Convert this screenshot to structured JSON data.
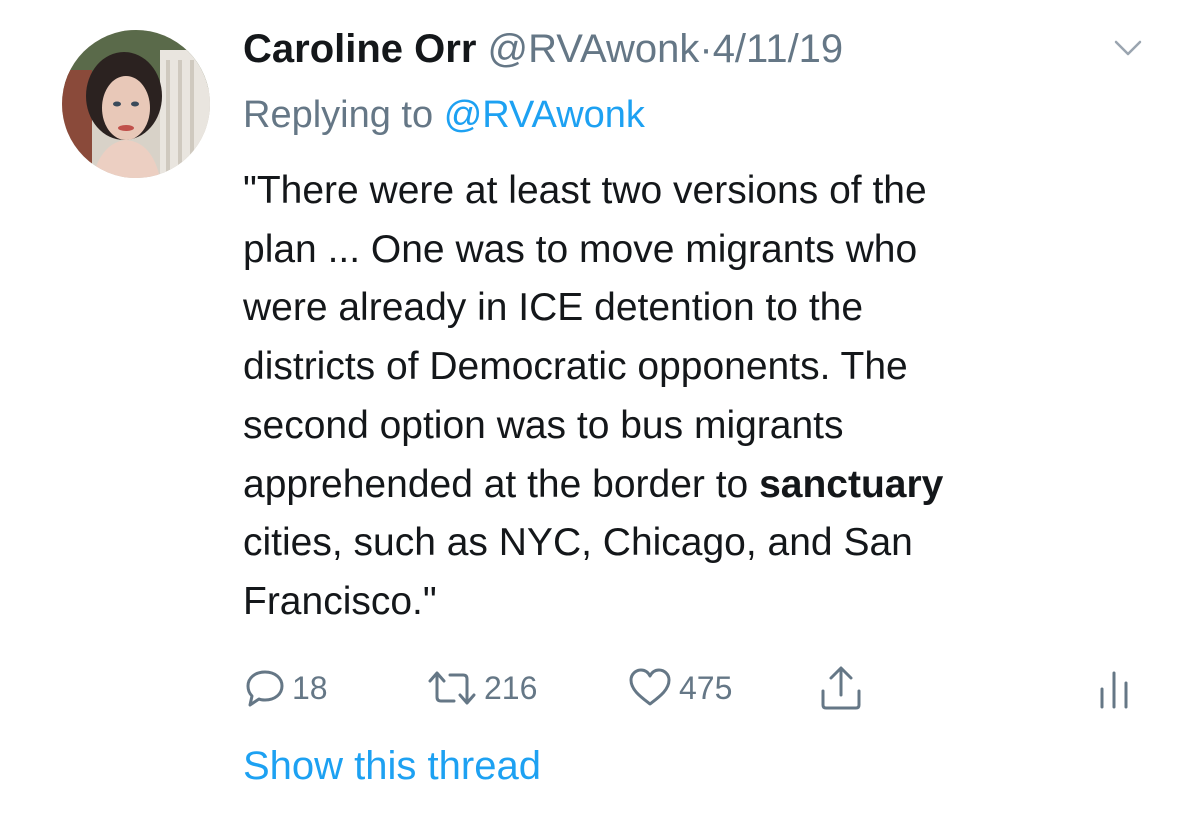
{
  "tweet": {
    "display_name": "Caroline Orr",
    "handle": "@RVAwonk",
    "separator": "·",
    "date": "4/11/19",
    "replying_prefix": "Replying to",
    "replying_handle": "@RVAwonk",
    "text_lines": [
      "\"There were at least two versions of the",
      "plan ... One was to move migrants who",
      "were already in ICE detention to the",
      "districts of Democratic opponents. The",
      "second option was to bus migrants"
    ],
    "text_line6_before": "apprehended at the border to",
    "text_line6_bold": "sanctuary",
    "text_lines_tail": [
      "cities, such as NYC, Chicago, and San",
      "Francisco.\""
    ],
    "actions": {
      "reply_count": "18",
      "retweet_count": "216",
      "like_count": "475"
    },
    "show_thread_label": "Show this thread",
    "icons": {
      "reply": "reply-icon",
      "retweet": "retweet-icon",
      "like": "heart-icon",
      "share": "share-icon",
      "analytics": "analytics-icon",
      "menu": "chevron-down-icon"
    },
    "colors": {
      "text": "#14171a",
      "secondary": "#657786",
      "link": "#1da1f2"
    }
  }
}
